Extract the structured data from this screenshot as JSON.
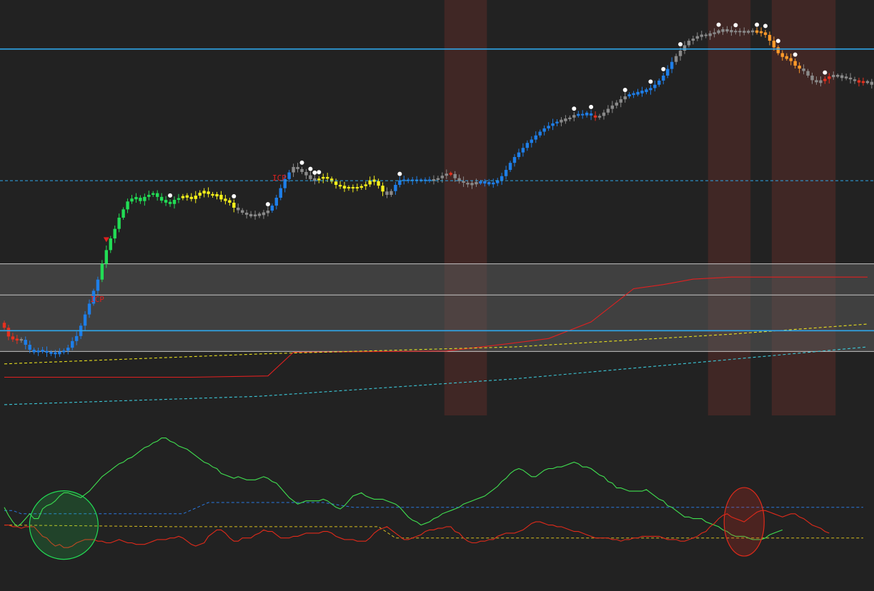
{
  "chart_data": [
    {
      "type": "candlestick",
      "title": "",
      "xlabel": "",
      "ylabel": "",
      "ylim": [
        0,
        100
      ],
      "grid": false,
      "legend": "none",
      "colors": {
        "background": "#222222",
        "blue": "#1e7ee8",
        "green": "#22dd55",
        "yellow": "#f5f01a",
        "grey": "#8a8a8a",
        "orange": "#ff9a2a",
        "red": "#e8301e",
        "session_band": "#5a2c28",
        "range_box": "#5a5a5a",
        "level_line": "#2ea8ec"
      },
      "annotations": [
        {
          "text": "ICP",
          "color": "#e02020"
        },
        {
          "text": "ICP",
          "color": "#e02020"
        }
      ],
      "markers": [
        "white-dot",
        "red-down-triangle"
      ],
      "horizontal_levels": [
        {
          "name": "upper-level",
          "value": 88.2,
          "style": "solid",
          "color": "#2ea8ec"
        },
        {
          "name": "mid-level",
          "value": 56.5,
          "style": "dashed",
          "color": "#2ea8ec"
        },
        {
          "name": "lower-level",
          "value": 20.4,
          "style": "solid",
          "color": "#2ea8ec"
        }
      ],
      "range_box": {
        "top": 36.5,
        "bottom": 15.4,
        "inner_line": 29.0
      },
      "session_bands": [
        [
          104,
          113
        ],
        [
          166,
          175
        ],
        [
          181,
          195
        ]
      ],
      "trend_lines": [
        {
          "name": "red-step",
          "color": "#e02020",
          "style": "solid",
          "points": [
            [
              0,
              9.2
            ],
            [
              44,
              9.2
            ],
            [
              62,
              9.5
            ],
            [
              68,
              15.2
            ],
            [
              104,
              15.5
            ],
            [
              118,
              17.2
            ],
            [
              128,
              18.5
            ],
            [
              138,
              22.5
            ],
            [
              148,
              30.5
            ],
            [
              155,
              31.5
            ],
            [
              162,
              32.8
            ],
            [
              171,
              33.3
            ],
            [
              203,
              33.3
            ]
          ]
        },
        {
          "name": "yellow-ma",
          "color": "#e8e020",
          "style": "dashed",
          "points": [
            [
              0,
              12.4
            ],
            [
              60,
              14.8
            ],
            [
              120,
              16.5
            ],
            [
              170,
              19.5
            ],
            [
              203,
              22.0
            ]
          ]
        },
        {
          "name": "cyan-ma",
          "color": "#3cc8d8",
          "style": "dashed",
          "points": [
            [
              0,
              2.6
            ],
            [
              60,
              4.6
            ],
            [
              120,
              8.8
            ],
            [
              170,
              13.4
            ],
            [
              203,
              16.5
            ]
          ]
        }
      ],
      "candles": {
        "colors": [
          "red",
          "red",
          "red",
          "red",
          "grey",
          "blue",
          "blue",
          "blue",
          "blue",
          "blue",
          "blue",
          "blue",
          "blue",
          "blue",
          "blue",
          "blue",
          "blue",
          "blue",
          "blue",
          "blue",
          "blue",
          "blue",
          "blue",
          "green",
          "green",
          "green",
          "green",
          "green",
          "green",
          "green",
          "green",
          "green",
          "green",
          "green",
          "green",
          "green",
          "green",
          "green",
          "green",
          "green",
          "green",
          "green",
          "yellow",
          "yellow",
          "yellow",
          "yellow",
          "yellow",
          "yellow",
          "yellow",
          "yellow",
          "yellow",
          "yellow",
          "yellow",
          "yellow",
          "yellow",
          "grey",
          "grey",
          "grey",
          "grey",
          "grey",
          "grey",
          "grey",
          "grey",
          "blue",
          "blue",
          "blue",
          "blue",
          "blue",
          "grey",
          "grey",
          "grey",
          "grey",
          "grey",
          "grey",
          "yellow",
          "yellow",
          "yellow",
          "yellow",
          "yellow",
          "yellow",
          "yellow",
          "yellow",
          "yellow",
          "yellow",
          "yellow",
          "yellow",
          "yellow",
          "yellow",
          "yellow",
          "yellow",
          "grey",
          "grey",
          "blue",
          "blue",
          "blue",
          "blue",
          "blue",
          "blue",
          "blue",
          "blue",
          "blue",
          "grey",
          "grey",
          "grey",
          "grey",
          "red",
          "grey",
          "grey",
          "grey",
          "grey",
          "grey",
          "grey",
          "blue",
          "blue",
          "blue",
          "blue",
          "blue",
          "blue",
          "blue",
          "blue",
          "blue",
          "blue",
          "blue",
          "blue",
          "blue",
          "blue",
          "blue",
          "blue",
          "blue",
          "blue",
          "blue",
          "grey",
          "grey",
          "grey",
          "grey",
          "blue",
          "blue",
          "blue",
          "blue",
          "red",
          "grey",
          "grey",
          "grey",
          "grey",
          "grey",
          "grey",
          "grey",
          "blue",
          "blue",
          "blue",
          "blue",
          "blue",
          "blue",
          "blue",
          "blue",
          "blue",
          "blue",
          "blue",
          "grey",
          "grey",
          "grey",
          "grey",
          "grey",
          "grey",
          "grey",
          "grey",
          "grey",
          "grey",
          "grey",
          "grey",
          "grey",
          "grey",
          "grey",
          "grey",
          "grey",
          "grey",
          "grey",
          "orange",
          "orange",
          "orange",
          "orange",
          "orange",
          "orange",
          "orange",
          "orange",
          "orange",
          "orange",
          "orange",
          "grey",
          "grey",
          "grey",
          "grey",
          "grey",
          "red",
          "red",
          "grey",
          "grey",
          "grey",
          "grey",
          "grey",
          "grey",
          "red",
          "red",
          "grey",
          "grey",
          "red",
          "red",
          "red",
          "red",
          "red",
          "grey",
          "grey",
          "grey",
          "grey"
        ],
        "closes": [
          21.1,
          19.0,
          18.3,
          18.2,
          18.2,
          17.0,
          15.8,
          15.2,
          15.6,
          15.5,
          15.1,
          15.0,
          14.9,
          15.2,
          15.6,
          16.3,
          17.9,
          19.1,
          21.6,
          24.3,
          26.9,
          30.0,
          32.7,
          36.5,
          39.8,
          42.6,
          44.9,
          47.6,
          49.6,
          51.5,
          52.2,
          52.4,
          51.6,
          52.6,
          53.1,
          53.5,
          52.6,
          51.7,
          51.4,
          50.9,
          51.9,
          52.3,
          52.8,
          52.6,
          52.1,
          52.9,
          53.6,
          53.9,
          53.3,
          52.9,
          53.1,
          52.0,
          51.8,
          51.2,
          50.0,
          49.4,
          48.8,
          48.3,
          48.1,
          48.2,
          48.4,
          48.7,
          49.3,
          50.5,
          52.4,
          54.7,
          56.9,
          58.5,
          59.8,
          59.3,
          58.6,
          57.8,
          56.9,
          56.6,
          57.0,
          57.4,
          57.0,
          56.3,
          55.5,
          55.1,
          54.8,
          54.8,
          54.8,
          54.8,
          55.2,
          55.6,
          56.6,
          56.4,
          55.3,
          53.9,
          53.1,
          54.0,
          55.5,
          56.6,
          56.6,
          56.6,
          56.6,
          56.6,
          56.6,
          56.6,
          56.6,
          56.7,
          57.1,
          57.7,
          58.2,
          58.1,
          57.1,
          56.4,
          56.0,
          55.6,
          55.8,
          56.0,
          56.2,
          56.0,
          55.8,
          55.9,
          56.6,
          57.6,
          59.1,
          60.8,
          62.2,
          63.3,
          64.4,
          65.6,
          66.4,
          67.4,
          68.3,
          69.1,
          69.7,
          70.3,
          70.7,
          71.0,
          71.3,
          71.7,
          72.3,
          72.4,
          72.4,
          72.7,
          72.2,
          71.7,
          72.1,
          72.9,
          73.8,
          74.6,
          75.3,
          76.1,
          76.8,
          77.3,
          77.4,
          77.7,
          78.0,
          78.3,
          78.8,
          79.6,
          80.6,
          81.8,
          83.4,
          85.1,
          86.5,
          87.8,
          89.1,
          90.2,
          90.7,
          91.3,
          91.5,
          91.5,
          91.8,
          92.2,
          92.5,
          92.8,
          92.6,
          92.4,
          92.4,
          92.4,
          92.3,
          92.4,
          92.5,
          92.3,
          92.2,
          91.6,
          90.2,
          88.6,
          87.2,
          86.3,
          86.0,
          85.3,
          84.2,
          83.5,
          82.9,
          81.8,
          80.7,
          80.2,
          80.5,
          81.0,
          81.6,
          81.8,
          81.7,
          81.4,
          81.3,
          80.9,
          80.5,
          80.3,
          80.2,
          80.3,
          79.6,
          78.9,
          78.4,
          77.8,
          76.9,
          76.2,
          75.4,
          75.4,
          76.2,
          77.2,
          77.7,
          78.0
        ]
      },
      "dot_markers": [
        39,
        54,
        62,
        70,
        72,
        73,
        74,
        93,
        134,
        138,
        146,
        152,
        155,
        159,
        168,
        172,
        177,
        179,
        182,
        186,
        193
      ],
      "triangle_markers": [
        24
      ]
    },
    {
      "type": "line",
      "title": "",
      "xlabel": "",
      "ylabel": "",
      "ylim": [
        0,
        100
      ],
      "legend": "none",
      "series": [
        {
          "color": "#40e050",
          "values": [
            51,
            46,
            42,
            39,
            41,
            44,
            47,
            44,
            44,
            50,
            52,
            53,
            55,
            58,
            60,
            60,
            59,
            58,
            57,
            59,
            61,
            64,
            67,
            70,
            72,
            74,
            76,
            78,
            79,
            81,
            82,
            84,
            86,
            88,
            89,
            91,
            92,
            94,
            94,
            92,
            91,
            89,
            88,
            87,
            85,
            83,
            81,
            79,
            78,
            76,
            75,
            72,
            71,
            70,
            69,
            70,
            69,
            68,
            68,
            68,
            69,
            70,
            69,
            67,
            66,
            63,
            60,
            57,
            55,
            53,
            54,
            55,
            55,
            55,
            55,
            56,
            55,
            53,
            51,
            50,
            52,
            55,
            58,
            59,
            60,
            58,
            57,
            56,
            56,
            56,
            55,
            54,
            53,
            51,
            48,
            45,
            43,
            42,
            40,
            41,
            42,
            44,
            45,
            47,
            48,
            49,
            50,
            51,
            53,
            54,
            55,
            56,
            57,
            58,
            60,
            62,
            64,
            67,
            69,
            72,
            74,
            75,
            74,
            72,
            70,
            70,
            72,
            74,
            75,
            75,
            76,
            76,
            77,
            78,
            79,
            78,
            76,
            76,
            75,
            73,
            71,
            70,
            67,
            66,
            63,
            63,
            62,
            61,
            61,
            61,
            61,
            62,
            60,
            58,
            56,
            55,
            52,
            51,
            49,
            47,
            45,
            45,
            44,
            44,
            44,
            42,
            41,
            40,
            39,
            37,
            36,
            34,
            33,
            33,
            33,
            32,
            31,
            31,
            31,
            32,
            34,
            35,
            36,
            37
          ]
        },
        {
          "color": "#e02a1a",
          "values": [
            40,
            40,
            39,
            39,
            38,
            39,
            39,
            39,
            36,
            33,
            32,
            29,
            27,
            28,
            26,
            26,
            27,
            29,
            30,
            31,
            31,
            31,
            30,
            30,
            29,
            29,
            30,
            31,
            30,
            29,
            29,
            28,
            28,
            28,
            29,
            30,
            31,
            31,
            31,
            32,
            32,
            33,
            32,
            30,
            28,
            27,
            28,
            29,
            33,
            35,
            37,
            37,
            35,
            32,
            30,
            30,
            32,
            32,
            32,
            34,
            35,
            37,
            36,
            36,
            34,
            32,
            32,
            32,
            33,
            33,
            34,
            35,
            35,
            35,
            35,
            36,
            36,
            35,
            33,
            32,
            31,
            31,
            31,
            30,
            30,
            30,
            32,
            35,
            37,
            38,
            39,
            37,
            35,
            33,
            31,
            31,
            32,
            33,
            34,
            36,
            37,
            37,
            38,
            38,
            39,
            39,
            36,
            35,
            32,
            30,
            29,
            29,
            30,
            30,
            31,
            31,
            33,
            34,
            35,
            35,
            35,
            36,
            37,
            39,
            41,
            42,
            42,
            41,
            40,
            40,
            39,
            39,
            38,
            37,
            36,
            36,
            35,
            34,
            33,
            32,
            32,
            32,
            32,
            31,
            31,
            30,
            31,
            31,
            32,
            32,
            33,
            33,
            33,
            33,
            33,
            32,
            31,
            31,
            31,
            30,
            30,
            31,
            32,
            33,
            35,
            36,
            39,
            41,
            44,
            46,
            47,
            45,
            44,
            43,
            42,
            44,
            46,
            48,
            49,
            49,
            48,
            47,
            46,
            45,
            46,
            47,
            47,
            45,
            44,
            42,
            40,
            39,
            38,
            36,
            35
          ]
        },
        {
          "name": "blue-signal",
          "color": "#2a78e0",
          "style": "dashed",
          "points": [
            [
              0,
              49
            ],
            [
              2,
              49
            ],
            [
              4,
              47
            ],
            [
              42,
              47
            ],
            [
              48,
              54
            ],
            [
              62,
              54
            ],
            [
              75,
              54
            ],
            [
              82,
              51
            ],
            [
              202,
              51
            ]
          ]
        },
        {
          "name": "yellow-signal",
          "color": "#d8c020",
          "style": "dashed",
          "points": [
            [
              0,
              40
            ],
            [
              40,
              39
            ],
            [
              80,
              39
            ],
            [
              88,
              39
            ],
            [
              92,
              32
            ],
            [
              202,
              32
            ]
          ]
        }
      ],
      "highlights": [
        {
          "name": "oversold-circle",
          "color": "#22dd55",
          "x": 14,
          "y": 40
        },
        {
          "name": "overbought-ellipse",
          "color": "#e02a1a",
          "x": 174,
          "y": 42
        }
      ]
    }
  ]
}
